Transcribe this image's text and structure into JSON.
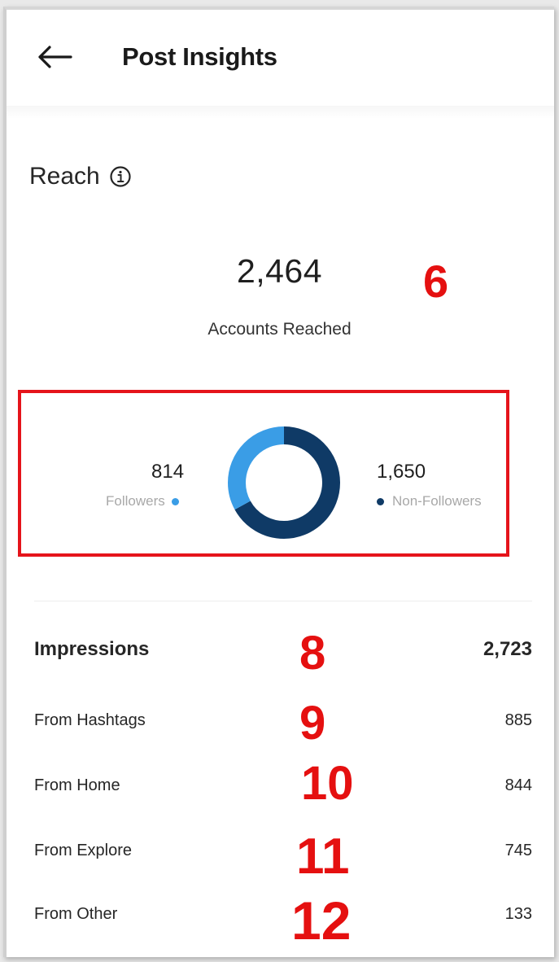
{
  "header": {
    "title": "Post Insights",
    "back_icon": "arrow-left-icon"
  },
  "reach": {
    "heading": "Reach",
    "info_icon": "info-circle-icon",
    "accounts_reached_value": "2,464",
    "accounts_reached_label": "Accounts Reached",
    "followers": {
      "value": "814",
      "label": "Followers",
      "color": "#3a9de6"
    },
    "non_followers": {
      "value": "1,650",
      "label": "Non-Followers",
      "color": "#0f3a66"
    }
  },
  "chart_data": {
    "type": "pie",
    "categories": [
      "Followers",
      "Non-Followers"
    ],
    "values": [
      814,
      1650
    ],
    "colors": [
      "#3a9de6",
      "#0f3a66"
    ]
  },
  "impressions": {
    "title": "Impressions",
    "total": "2,723",
    "rows": [
      {
        "label": "From Hashtags",
        "value": "885"
      },
      {
        "label": "From Home",
        "value": "844"
      },
      {
        "label": "From Explore",
        "value": "745"
      },
      {
        "label": "From Other",
        "value": "133"
      }
    ]
  },
  "annotations": {
    "a6": "6",
    "a8": "8",
    "a9": "9",
    "a10": "10",
    "a11": "11",
    "a12": "12",
    "highlight_color": "#e5141b"
  }
}
